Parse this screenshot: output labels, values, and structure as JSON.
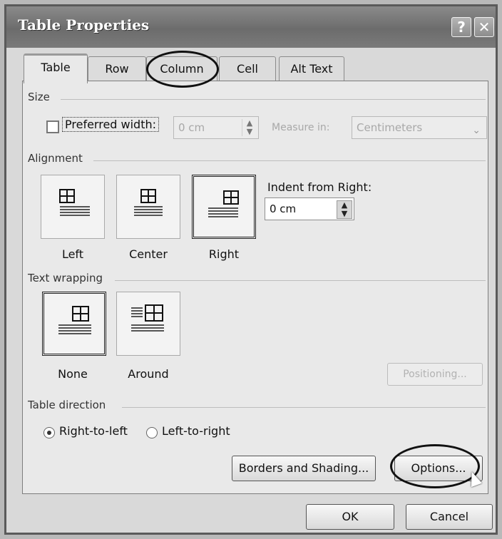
{
  "dialog": {
    "title": "Table Properties",
    "help_glyph": "?",
    "close_glyph": "✕"
  },
  "tabs": [
    {
      "label": "Table",
      "active": true
    },
    {
      "label": "Row",
      "active": false
    },
    {
      "label": "Column",
      "active": false
    },
    {
      "label": "Cell",
      "active": false
    },
    {
      "label": "Alt Text",
      "active": false
    }
  ],
  "size": {
    "section_label": "Size",
    "preferred_width_label": "Preferred width:",
    "preferred_width_checked": false,
    "width_value": "0 cm",
    "measure_in_label": "Measure in:",
    "measure_in_value": "Centimeters"
  },
  "alignment": {
    "section_label": "Alignment",
    "options": [
      "Left",
      "Center",
      "Right"
    ],
    "selected": "Right",
    "indent_label": "Indent from Right:",
    "indent_value": "0 cm"
  },
  "text_wrapping": {
    "section_label": "Text wrapping",
    "options": [
      "None",
      "Around"
    ],
    "selected": "None",
    "positioning_label": "Positioning..."
  },
  "table_direction": {
    "section_label": "Table direction",
    "options": [
      {
        "label": "Right-to-left",
        "checked": true
      },
      {
        "label": "Left-to-right",
        "checked": false
      }
    ]
  },
  "buttons": {
    "borders_shading": "Borders and Shading...",
    "options": "Options...",
    "ok": "OK",
    "cancel": "Cancel"
  },
  "icons": {
    "help": "question-mark-icon",
    "close": "close-icon",
    "cursor": "mouse-pointer-icon"
  }
}
